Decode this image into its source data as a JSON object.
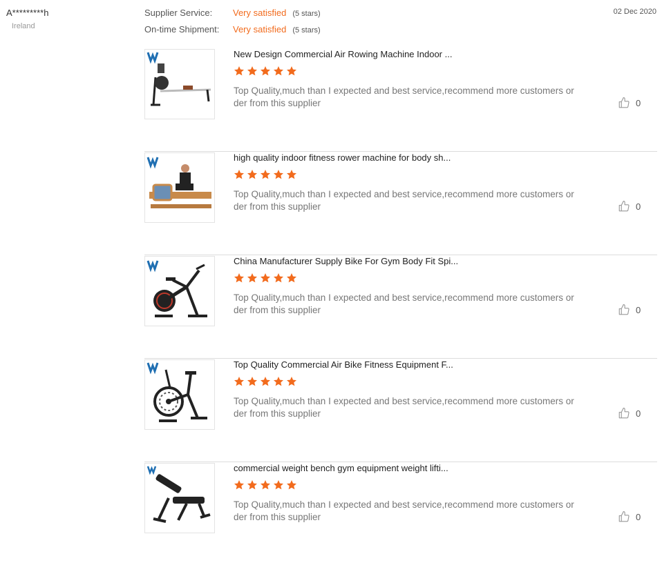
{
  "reviewer": {
    "name": "A*********h",
    "country": "Ireland"
  },
  "ratings": [
    {
      "label": "Supplier Service:",
      "value": "Very satisfied",
      "stars": "(5 stars)"
    },
    {
      "label": "On-time Shipment:",
      "value": "Very satisfied",
      "stars": "(5 stars)"
    }
  ],
  "date": "02 Dec 2020",
  "colors": {
    "accent": "#f26b1d",
    "brand_logo": "#1f6fb2"
  },
  "products": [
    {
      "title": "New Design Commercial Air Rowing Machine Indoor ...",
      "rating": 5,
      "comment": "Top Quality,much than I expected and best service,recommend more customers order from this supplier",
      "likes": "0",
      "image": "air-rowing-machine"
    },
    {
      "title": "high quality indoor fitness rower machine for body sh...",
      "rating": 5,
      "comment": "Top Quality,much than I expected and best service,recommend more customers order from this supplier",
      "likes": "0",
      "image": "wooden-water-rower"
    },
    {
      "title": "China Manufacturer Supply Bike For Gym Body Fit Spi...",
      "rating": 5,
      "comment": "Top Quality,much than I expected and best service,recommend more customers order from this supplier",
      "likes": "0",
      "image": "spin-bike"
    },
    {
      "title": "Top Quality Commercial Air Bike Fitness Equipment F...",
      "rating": 5,
      "comment": "Top Quality,much than I expected and best service,recommend more customers order from this supplier",
      "likes": "0",
      "image": "air-bike"
    },
    {
      "title": "commercial weight bench gym equipment weight lifti...",
      "rating": 5,
      "comment": "Top Quality,much than I expected and best service,recommend more customers order from this supplier",
      "likes": "0",
      "image": "weight-bench"
    }
  ]
}
